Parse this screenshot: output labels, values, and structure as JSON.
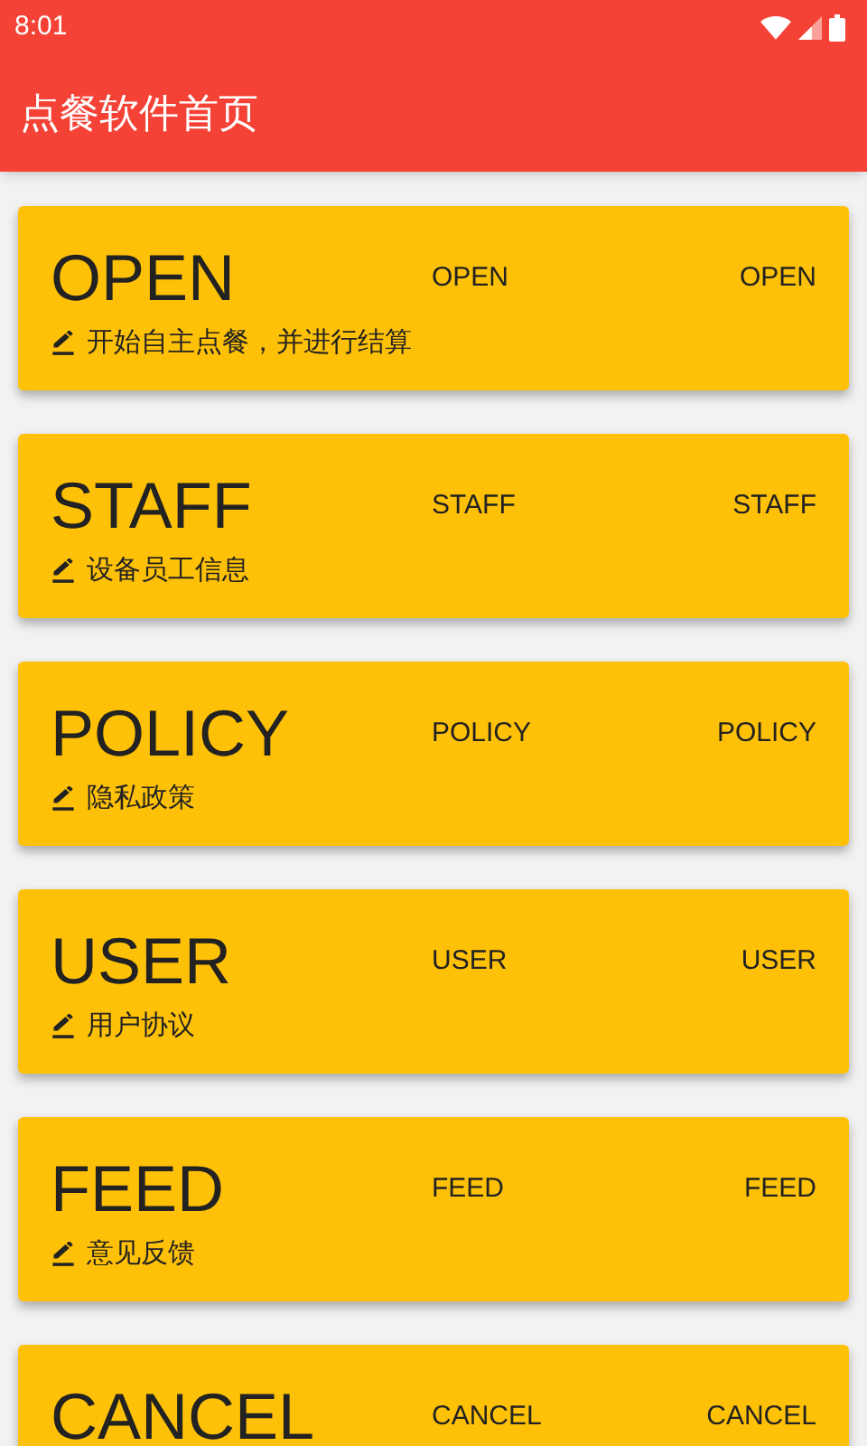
{
  "status_bar": {
    "time": "8:01"
  },
  "app_bar": {
    "title": "点餐软件首页"
  },
  "cards": [
    {
      "title": "OPEN",
      "label_2": "OPEN",
      "label_3": "OPEN",
      "subtitle": "开始自主点餐，并进行结算"
    },
    {
      "title": "STAFF",
      "label_2": "STAFF",
      "label_3": "STAFF",
      "subtitle": "设备员工信息"
    },
    {
      "title": "POLICY",
      "label_2": "POLICY",
      "label_3": "POLICY",
      "subtitle": "隐私政策"
    },
    {
      "title": "USER",
      "label_2": "USER",
      "label_3": "USER",
      "subtitle": "用户协议"
    },
    {
      "title": "FEED",
      "label_2": "FEED",
      "label_3": "FEED",
      "subtitle": "意见反馈"
    },
    {
      "title": "CANCEL",
      "label_2": "CANCEL",
      "label_3": "CANCEL"
    }
  ]
}
